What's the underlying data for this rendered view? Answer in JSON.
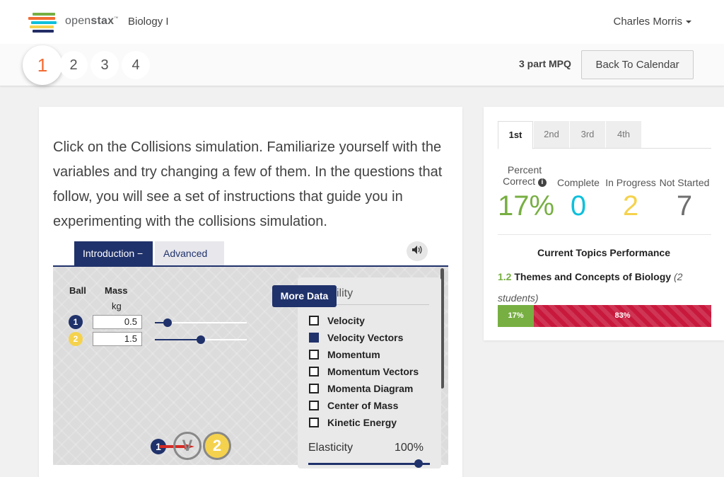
{
  "colors": {
    "accent_orange": "#f36b32",
    "sim_navy": "#20326b",
    "correct_green": "#77af42",
    "complete_blue": "#0dc0dc",
    "in_progress_yellow": "#f5d24d",
    "not_started_gray": "#6f6f6f",
    "incorrect_red": "#c8193c"
  },
  "navbar": {
    "logo_text_light": "open",
    "logo_text_bold": "stax",
    "logo_tm": "™",
    "course_title": "Biology I",
    "user_name": "Charles Morris"
  },
  "subheader": {
    "steps": [
      "1",
      "2",
      "3",
      "4"
    ],
    "active_step": "1",
    "mpq_label": "3 part MPQ",
    "back_button": "Back To Calendar"
  },
  "task": {
    "question": "Click on the Collisions simulation. Familiarize yourself with the variables and try changing a few of them. In the questions that follow, you will see a set of instructions that guide you in experimenting with the collisions simulation."
  },
  "simulation": {
    "tabs": {
      "introduction": "Introduction −",
      "advanced": "Advanced +"
    },
    "sound_icon": "speaker-icon",
    "columns": {
      "ball": "Ball",
      "mass": "Mass",
      "unit": "kg"
    },
    "balls": [
      {
        "id": "1",
        "mass": "0.5",
        "slider_fraction": 0.14,
        "color": "#20326b"
      },
      {
        "id": "2",
        "mass": "1.5",
        "slider_fraction": 0.5,
        "color": "#f5d24d"
      }
    ],
    "more_data_button": "More Data",
    "panel_label": "ility",
    "checkboxes": [
      {
        "label": "Velocity",
        "checked": false
      },
      {
        "label": "Velocity Vectors",
        "checked": true
      },
      {
        "label": "Momentum",
        "checked": false
      },
      {
        "label": "Momentum Vectors",
        "checked": false
      },
      {
        "label": "Momenta Diagram",
        "checked": false
      },
      {
        "label": "Center of Mass",
        "checked": false
      },
      {
        "label": "Kinetic Energy",
        "checked": false
      }
    ],
    "elasticity_label": "Elasticity",
    "elasticity_value": "100%",
    "canvas": {
      "ball1_label": "1",
      "v_label": "V",
      "ball2_label": "2"
    }
  },
  "stats": {
    "period_tabs": [
      "1st",
      "2nd",
      "3rd",
      "4th"
    ],
    "active_period": "1st",
    "percent_correct_label_line1": "Percent",
    "percent_correct_label_line2": "Correct",
    "info_icon": "i",
    "percent_correct": "17%",
    "complete_label": "Complete",
    "complete": "0",
    "in_progress_label": "In Progress",
    "in_progress": "2",
    "not_started_label": "Not Started",
    "not_started": "7",
    "topics_title": "Current Topics Performance",
    "topic": {
      "number": "1.2",
      "name": "Themes and Concepts of Biology",
      "students": "(2 students)"
    },
    "performance": {
      "correct_label": "17%",
      "correct_fraction": 0.17,
      "incorrect_label": "83%",
      "incorrect_fraction": 0.83
    }
  }
}
